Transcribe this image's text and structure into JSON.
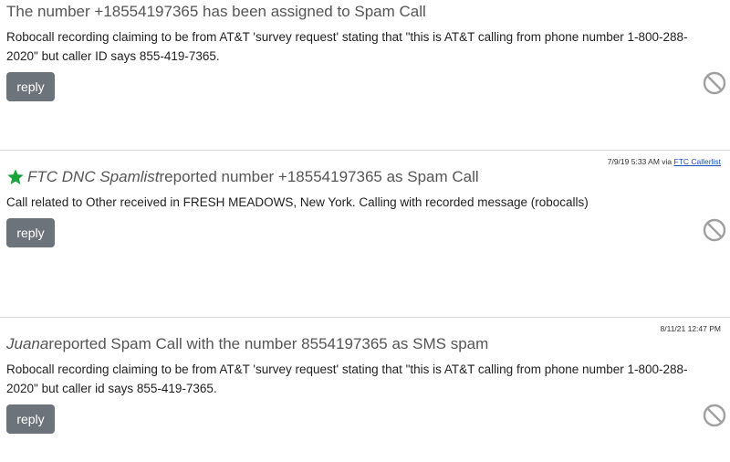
{
  "entries": [
    {
      "title": "The number +18554197365 has been assigned to Spam Call",
      "body": "Robocall recording claiming to be from AT&T 'survey request' stating that \"this is AT&T calling from phone number 1-800-288-2020\" but caller ID says 855-419-7365.",
      "reply_label": "reply"
    },
    {
      "meta_time": "7/9/19 5:33 AM via ",
      "meta_link": "FTC Callerlist",
      "reporter": "FTC DNC Spamlist",
      "title_rest": " reported number +18554197365 as Spam Call",
      "body": "Call related to Other received in FRESH MEADOWS, New York. Calling with recorded message (robocalls)",
      "reply_label": "reply",
      "star_color": "#1aa33a"
    },
    {
      "meta_time": "8/11/21 12:47 PM",
      "reporter": "Juana",
      "title_rest": " reported Spam Call with the number 8554197365 as SMS spam",
      "body": "Robocall recording claiming to be from AT&T 'survey request' stating that \"this is AT&T calling from phone number 1-800-288-2020\" but caller id says 855-419-7365.",
      "reply_label": "reply"
    }
  ],
  "icons": {
    "block": "block-icon",
    "star": "star-icon"
  }
}
